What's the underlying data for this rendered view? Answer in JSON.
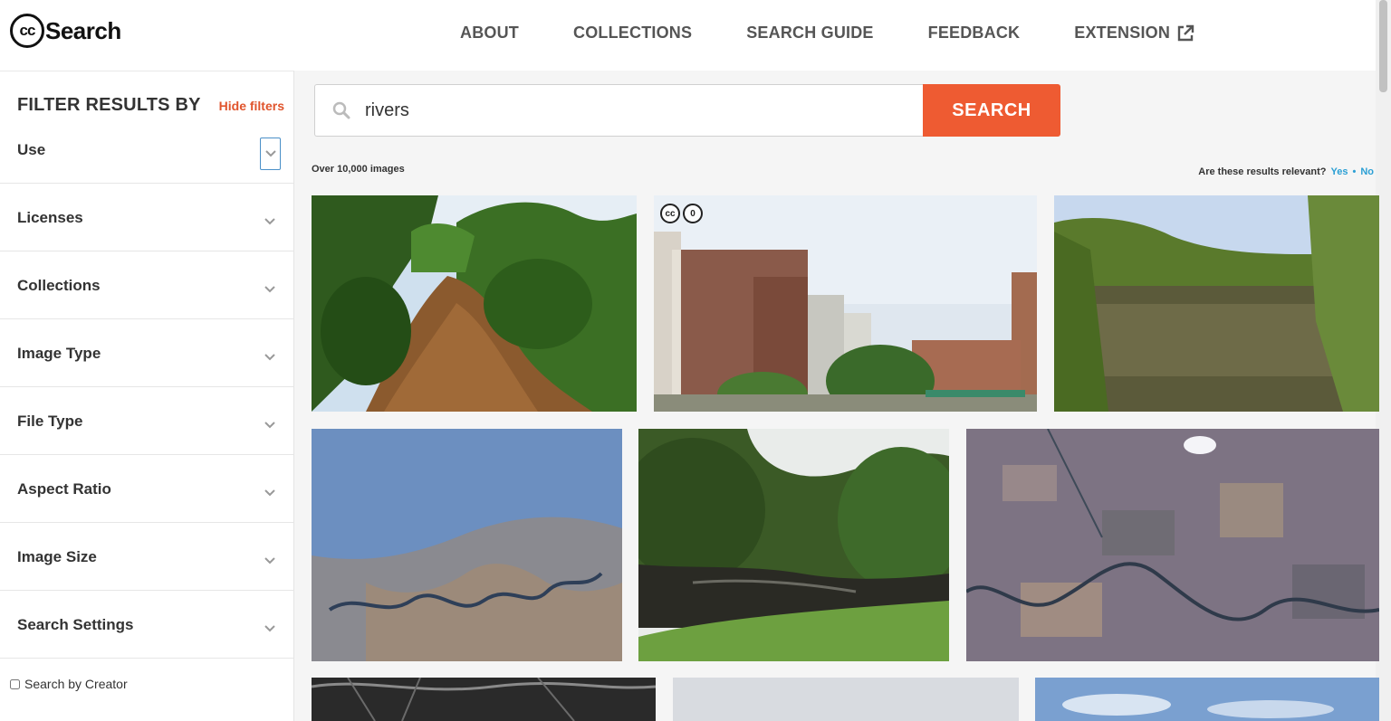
{
  "header": {
    "logo_mark": "cc",
    "logo_text": "Search",
    "nav": [
      {
        "label": "ABOUT"
      },
      {
        "label": "COLLECTIONS"
      },
      {
        "label": "SEARCH GUIDE"
      },
      {
        "label": "FEEDBACK"
      },
      {
        "label": "EXTENSION",
        "icon": "external-link-icon"
      }
    ]
  },
  "sidebar": {
    "heading": "FILTER RESULTS BY",
    "hide_filters": "Hide filters",
    "filters": [
      {
        "label": "Use"
      },
      {
        "label": "Licenses"
      },
      {
        "label": "Collections"
      },
      {
        "label": "Image Type"
      },
      {
        "label": "File Type"
      },
      {
        "label": "Aspect Ratio"
      },
      {
        "label": "Image Size"
      },
      {
        "label": "Search Settings"
      }
    ],
    "search_by_creator": "Search by Creator"
  },
  "search": {
    "query": "rivers",
    "button_label": "SEARCH"
  },
  "results": {
    "count": "Over 10,000 images",
    "relevance_question": "Are these results relevant?",
    "yes": "Yes",
    "separator": "•",
    "no": "No",
    "license_badges": [
      "cc",
      "0"
    ]
  },
  "colors": {
    "accent": "#ee5b32",
    "link": "#2b9fd4",
    "hide_filters": "#e0542c"
  }
}
